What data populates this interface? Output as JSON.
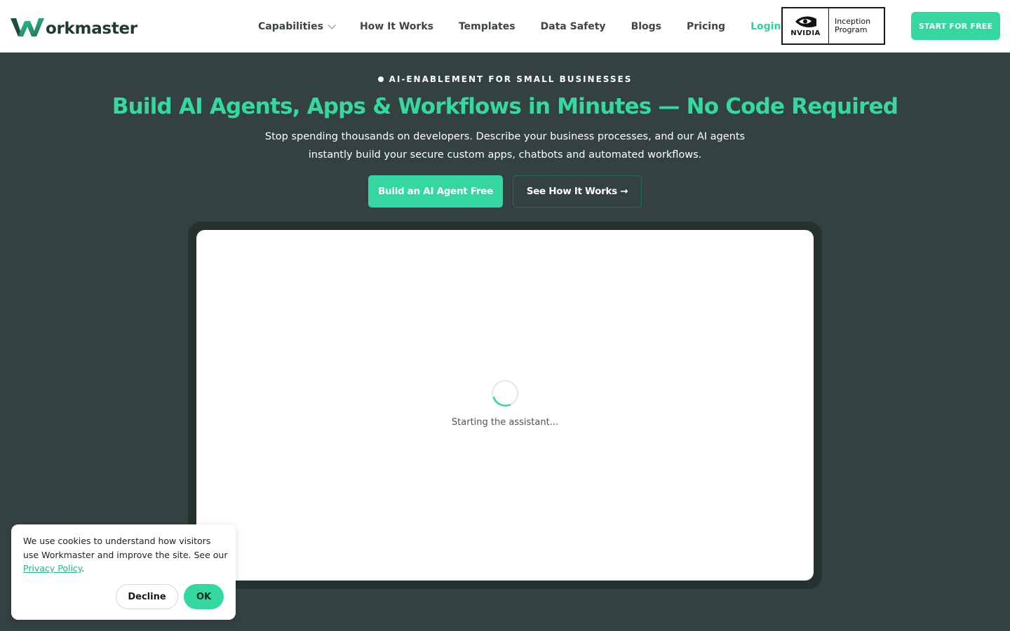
{
  "brand": {
    "name": "orkmaster",
    "logo_alt": "Workmaster",
    "logo_icon": "w-logo-mark",
    "primary_color": "#34d7a1",
    "dark_text_color": "#1f3a35",
    "hero_bg_color": "#334240"
  },
  "nav": {
    "items": [
      {
        "label": "Capabilities",
        "has_dropdown": true
      },
      {
        "label": "How It Works"
      },
      {
        "label": "Templates"
      },
      {
        "label": "Data Safety"
      },
      {
        "label": "Blogs"
      },
      {
        "label": "Pricing"
      }
    ],
    "login_label": "Login",
    "partner_badge": {
      "brand": "NVIDIA",
      "line1": "Inception",
      "line2": "Program",
      "icon": "nvidia-eye-icon"
    },
    "cta_label": "START FOR FREE"
  },
  "hero": {
    "eyebrow": "AI-ENABLEMENT FOR SMALL BUSINESSES",
    "title": "Build AI Agents, Apps & Workflows in Minutes — No Code Required",
    "subtitle_line1": "Stop spending thousands on developers. Describe your business processes, and our AI agents",
    "subtitle_line2": "instantly build your secure custom apps, chatbots and automated workflows.",
    "primary_button": "Build an AI Agent Free",
    "secondary_button": "See How It Works →"
  },
  "assistant": {
    "status_text": "Starting the assistant...",
    "spinner_icon": "loading-spinner-icon"
  },
  "cookie_banner": {
    "text_before": "We use cookies to understand how visitors use Workmaster and improve the site. See our ",
    "link_label": "Privacy Policy",
    "text_after": ".",
    "decline_label": "Decline",
    "ok_label": "OK"
  }
}
